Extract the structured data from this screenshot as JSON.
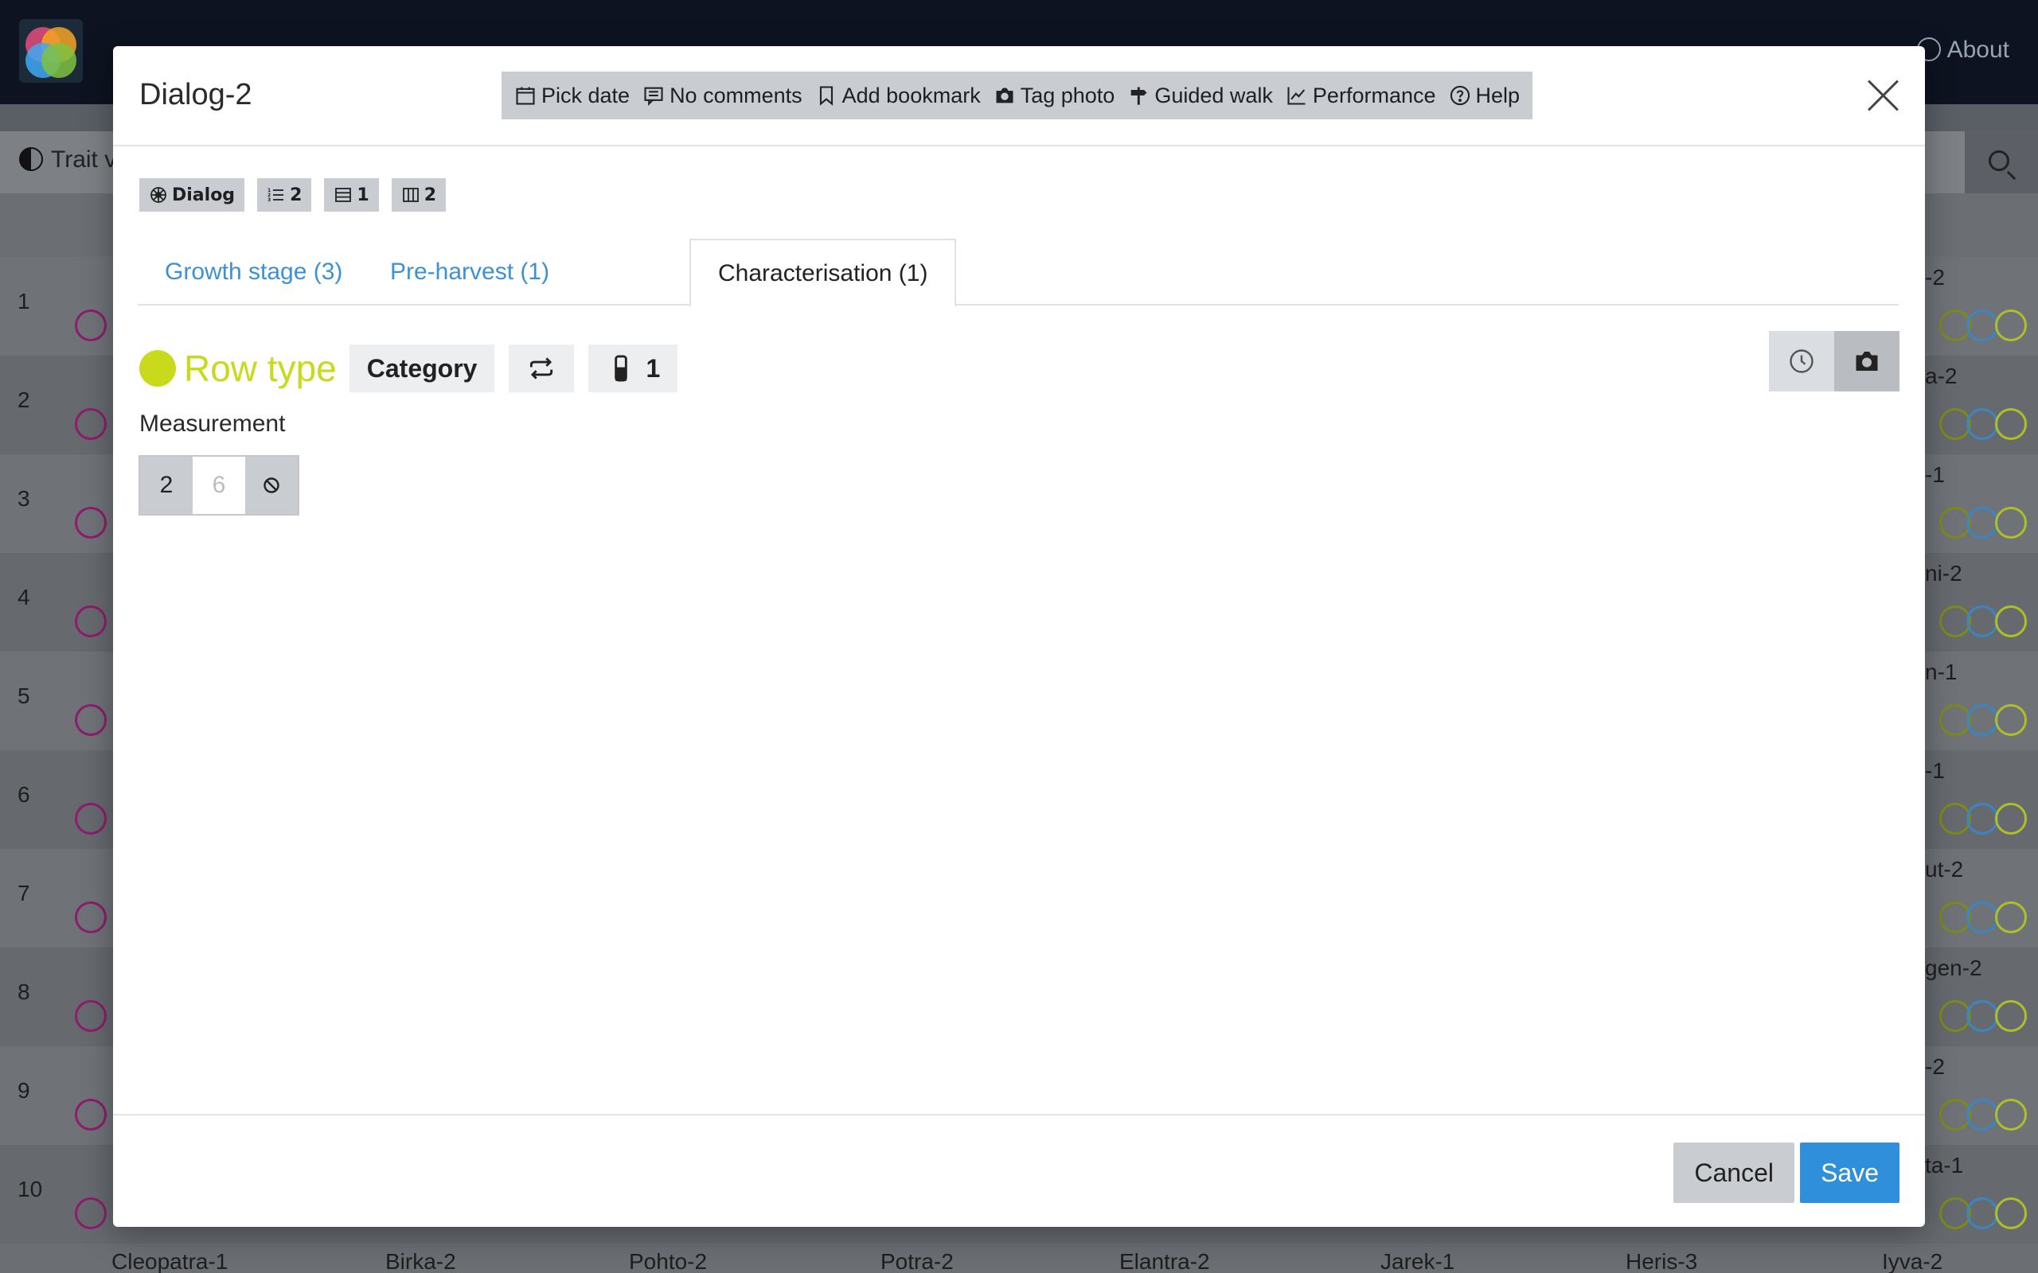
{
  "background": {
    "about_label": "About",
    "trait_label": "Trait v",
    "row_numbers": [
      "1",
      "2",
      "3",
      "4",
      "5",
      "6",
      "7",
      "8",
      "9",
      "10"
    ],
    "right_cells": [
      "-2",
      "a-2",
      "-1",
      "ni-2",
      "n-1",
      "-1",
      "ut-2",
      "gen-2",
      "-2",
      "ta-1"
    ],
    "column_headers": [
      "Cleopatra-1",
      "Birka-2",
      "Pohto-2",
      "Potra-2",
      "Elantra-2",
      "Jarek-1",
      "Heris-3",
      "Iyva-2"
    ]
  },
  "dialog": {
    "title": "Dialog-2",
    "actions": [
      {
        "label": "Pick date",
        "icon": "calendar-icon"
      },
      {
        "label": "No comments",
        "icon": "comment-icon"
      },
      {
        "label": "Add bookmark",
        "icon": "bookmark-icon"
      },
      {
        "label": "Tag photo",
        "icon": "camera-icon"
      },
      {
        "label": "Guided walk",
        "icon": "signpost-icon"
      },
      {
        "label": "Performance",
        "icon": "graph-icon"
      },
      {
        "label": "Help",
        "icon": "question-icon"
      }
    ],
    "badges": [
      {
        "label": "Dialog",
        "icon": "dialog-icon"
      },
      {
        "label": "2",
        "icon": "list-icon"
      },
      {
        "label": "1",
        "icon": "rows-icon"
      },
      {
        "label": "2",
        "icon": "columns-icon"
      }
    ],
    "tabs": [
      {
        "label": "Growth stage (3)",
        "active": false
      },
      {
        "label": "Pre-harvest (1)",
        "active": false
      },
      {
        "label": "Characterisation (1)",
        "active": true
      }
    ],
    "trait": {
      "name": "Row type",
      "color": "#c8da1b",
      "data_type": "Category",
      "repeat_icon": "repeat-icon",
      "allowed_count": "1"
    },
    "measurement": {
      "label": "Measurement",
      "value": "2",
      "placeholder": "6"
    },
    "footer": {
      "cancel_label": "Cancel",
      "save_label": "Save"
    }
  }
}
